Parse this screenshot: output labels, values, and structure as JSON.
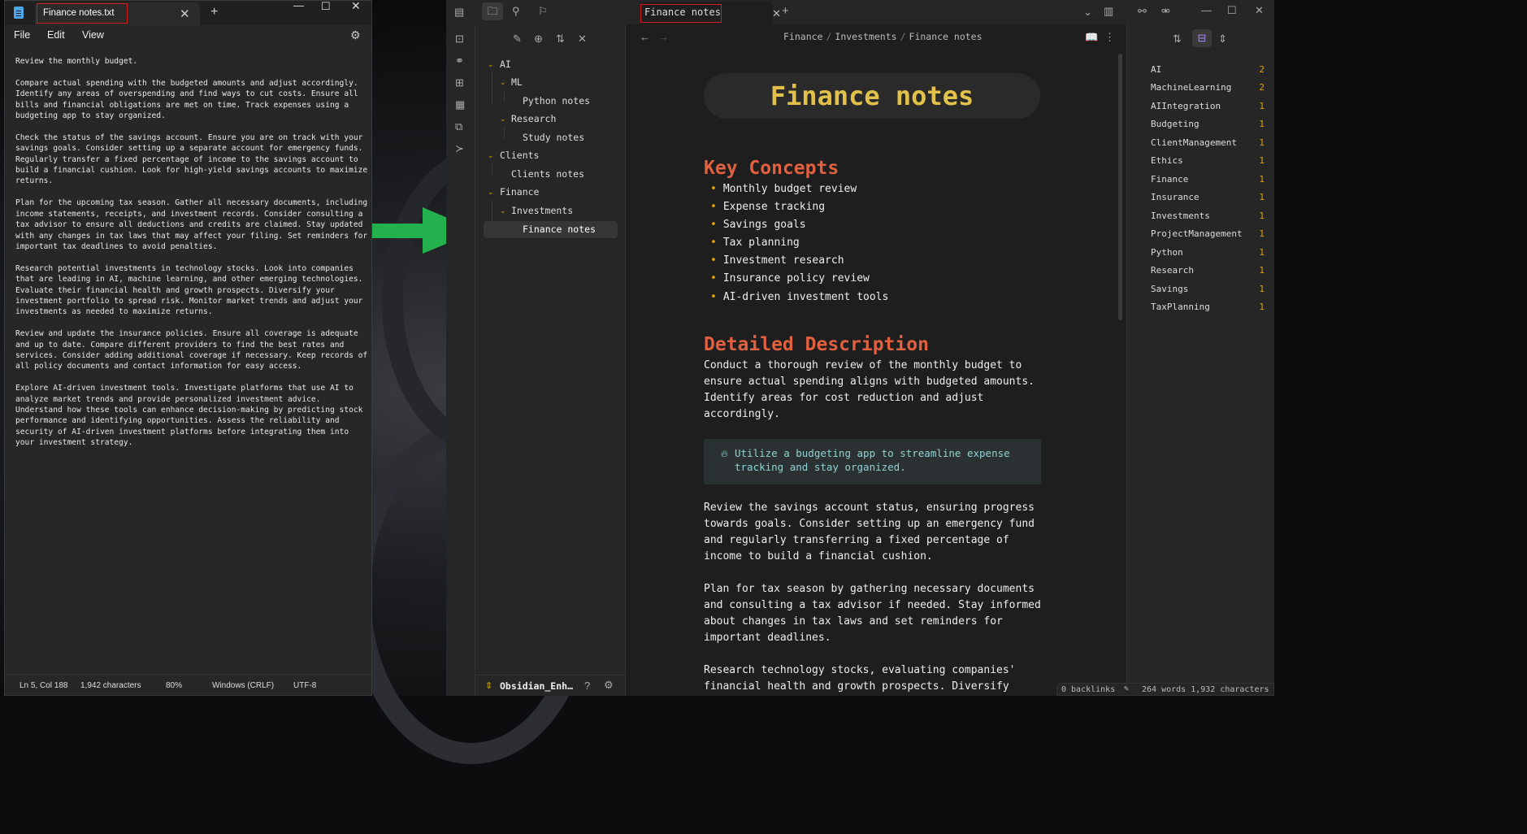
{
  "notepad": {
    "tab_title": "Finance notes.txt",
    "menu": [
      "File",
      "Edit",
      "View"
    ],
    "content": "Review the monthly budget.\n\nCompare actual spending with the budgeted amounts and adjust accordingly.\nIdentify any areas of overspending and find ways to cut costs. Ensure all\nbills and financial obligations are met on time. Track expenses using a\nbudgeting app to stay organized.\n\nCheck the status of the savings account. Ensure you are on track with your\nsavings goals. Consider setting up a separate account for emergency funds.\nRegularly transfer a fixed percentage of income to the savings account to\nbuild a financial cushion. Look for high-yield savings accounts to maximize\nreturns.\n\nPlan for the upcoming tax season. Gather all necessary documents, including\nincome statements, receipts, and investment records. Consider consulting a\ntax advisor to ensure all deductions and credits are claimed. Stay updated\nwith any changes in tax laws that may affect your filing. Set reminders for\nimportant tax deadlines to avoid penalties.\n\nResearch potential investments in technology stocks. Look into companies\nthat are leading in AI, machine learning, and other emerging technologies.\nEvaluate their financial health and growth prospects. Diversify your\ninvestment portfolio to spread risk. Monitor market trends and adjust your\ninvestments as needed to maximize returns.\n\nReview and update the insurance policies. Ensure all coverage is adequate\nand up to date. Compare different providers to find the best rates and\nservices. Consider adding additional coverage if necessary. Keep records of\nall policy documents and contact information for easy access.\n\nExplore AI-driven investment tools. Investigate platforms that use AI to\nanalyze market trends and provide personalized investment advice.\nUnderstand how these tools can enhance decision-making by predicting stock\nperformance and identifying opportunities. Assess the reliability and\nsecurity of AI-driven investment platforms before integrating them into\nyour investment strategy.",
    "status": {
      "position": "Ln 5, Col 188",
      "characters": "1,942 characters",
      "zoom": "80%",
      "line_ending": "Windows (CRLF)",
      "encoding": "UTF-8"
    }
  },
  "obsidian": {
    "tab_title": "Finance notes",
    "breadcrumb": [
      "Finance",
      "Investments",
      "Finance notes"
    ],
    "tree": {
      "ai": "AI",
      "ml": "ML",
      "python_notes": "Python notes",
      "research": "Research",
      "study_notes": "Study notes",
      "clients": "Clients",
      "clients_notes": "Clients notes",
      "finance": "Finance",
      "investments": "Investments",
      "finance_notes": "Finance notes"
    },
    "vault_name": "Obsidian_Enh…",
    "note": {
      "title": "Finance notes",
      "h_key": "Key Concepts",
      "bullets": [
        "Monthly budget review",
        "Expense tracking",
        "Savings goals",
        "Tax planning",
        "Investment research",
        "Insurance policy review",
        "AI-driven investment tools"
      ],
      "h_detail": "Detailed Description",
      "p1": "Conduct a thorough review of the monthly budget to ensure actual spending aligns with budgeted amounts. Identify areas for cost reduction and adjust accordingly.",
      "callout": "Utilize a budgeting app to streamline expense tracking and stay organized.",
      "p2": "Review the savings account status, ensuring progress towards goals. Consider setting up an emergency fund and regularly transferring a fixed percentage of income to build a financial cushion.",
      "p3": "Plan for tax season by gathering necessary documents and consulting a tax advisor if needed. Stay informed about changes in tax laws and set reminders for important deadlines.",
      "p4": "Research technology stocks, evaluating companies' financial health and growth prospects. Diversify"
    },
    "tags": [
      {
        "name": "AI",
        "count": "2"
      },
      {
        "name": "MachineLearning",
        "count": "2"
      },
      {
        "name": "AIIntegration",
        "count": "1"
      },
      {
        "name": "Budgeting",
        "count": "1"
      },
      {
        "name": "ClientManagement",
        "count": "1"
      },
      {
        "name": "Ethics",
        "count": "1"
      },
      {
        "name": "Finance",
        "count": "1"
      },
      {
        "name": "Insurance",
        "count": "1"
      },
      {
        "name": "Investments",
        "count": "1"
      },
      {
        "name": "ProjectManagement",
        "count": "1"
      },
      {
        "name": "Python",
        "count": "1"
      },
      {
        "name": "Research",
        "count": "1"
      },
      {
        "name": "Savings",
        "count": "1"
      },
      {
        "name": "TaxPlanning",
        "count": "1"
      }
    ],
    "status": {
      "backlinks": "0 backlinks",
      "counts": "264 words 1,932 characters"
    }
  },
  "colors": {
    "accent_gold": "#e2c14a",
    "heading_orange": "#e0603f",
    "arrow_green": "#22b14c",
    "highlight_red": "#d01c1c"
  }
}
